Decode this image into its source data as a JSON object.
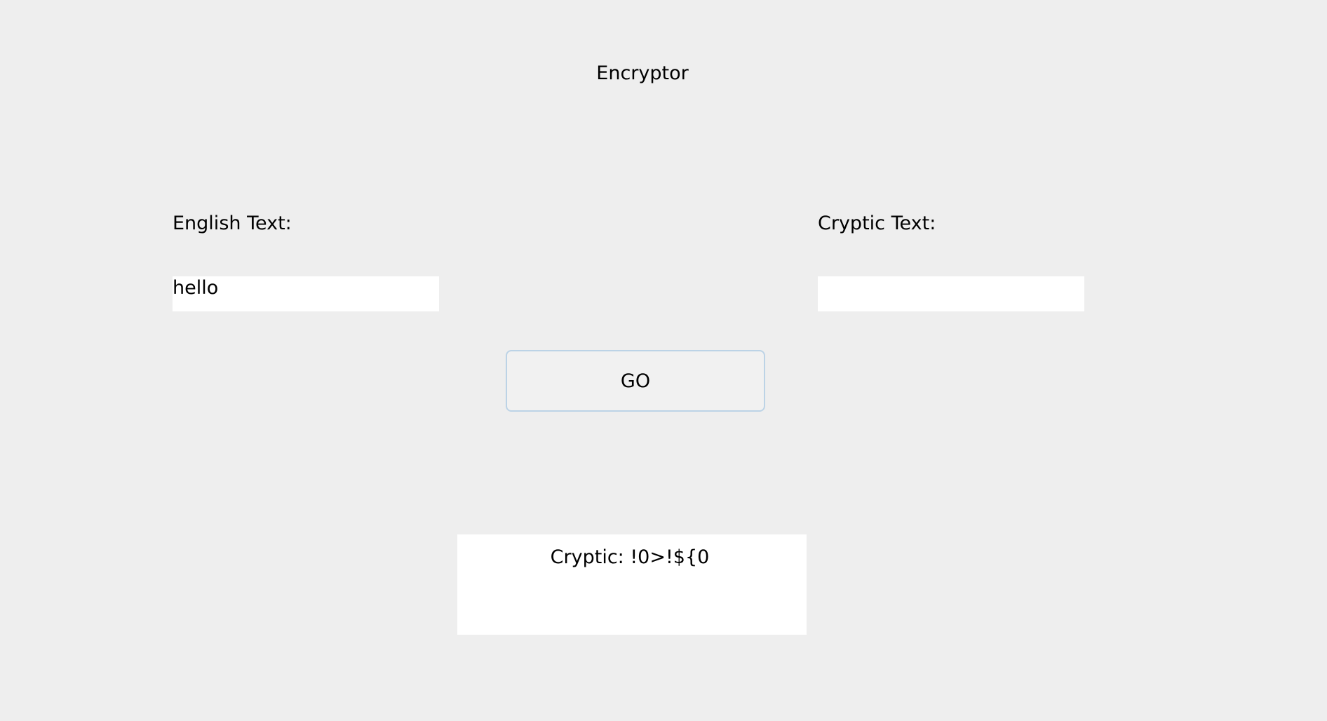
{
  "window": {
    "title": "Encryptor"
  },
  "english": {
    "label": "English Text:",
    "value": "hello"
  },
  "cryptic": {
    "label": "Cryptic Text:",
    "value": ""
  },
  "go_button": {
    "label": "GO"
  },
  "output": {
    "text": "Cryptic: !0>!${0"
  },
  "colors": {
    "background": "#eeeeee",
    "field_background": "#ffffff",
    "button_background": "#f1f1f1",
    "button_border": "#bcd3e6"
  }
}
